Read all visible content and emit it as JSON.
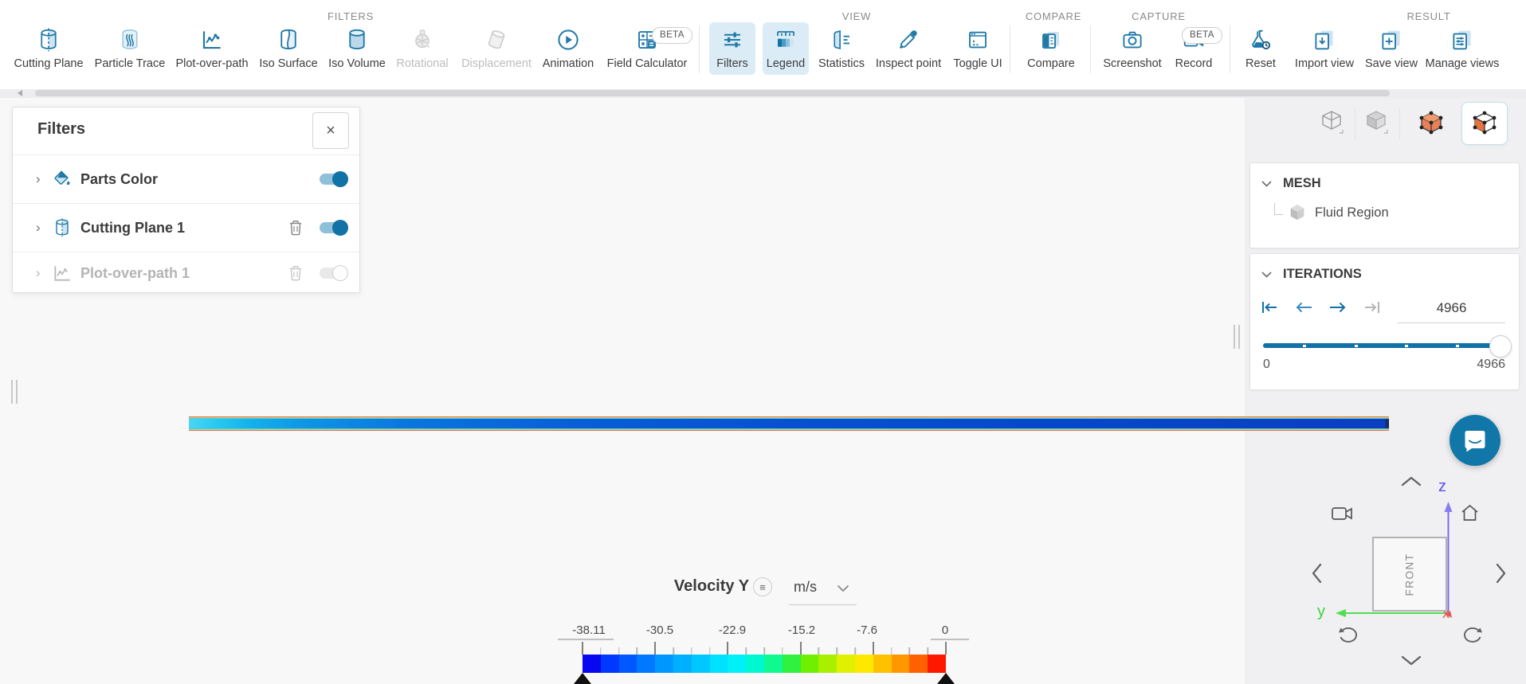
{
  "toolbar": {
    "beta_label": "BETA",
    "sections": [
      {
        "label": "FILTERS",
        "items": [
          {
            "label": "Cutting Plane"
          },
          {
            "label": "Particle Trace"
          },
          {
            "label": "Plot-over-path"
          },
          {
            "label": "Iso Surface"
          },
          {
            "label": "Iso Volume"
          },
          {
            "label": "Rotational",
            "disabled": true
          },
          {
            "label": "Displacement",
            "disabled": true
          },
          {
            "label": "Animation"
          },
          {
            "label": "Field Calculator",
            "beta": true
          }
        ]
      },
      {
        "label": "VIEW",
        "items": [
          {
            "label": "Filters",
            "active": true
          },
          {
            "label": "Legend",
            "active": true
          },
          {
            "label": "Statistics"
          },
          {
            "label": "Inspect point"
          },
          {
            "label": "Toggle UI"
          }
        ]
      },
      {
        "label": "COMPARE",
        "items": [
          {
            "label": "Compare"
          }
        ]
      },
      {
        "label": "CAPTURE",
        "items": [
          {
            "label": "Screenshot"
          },
          {
            "label": "Record",
            "beta": true
          }
        ]
      },
      {
        "label": "RESULT",
        "items": [
          {
            "label": "Reset"
          },
          {
            "label": "Import view"
          },
          {
            "label": "Save view"
          },
          {
            "label": "Manage views"
          }
        ]
      }
    ]
  },
  "filters_panel": {
    "title": "Filters",
    "rows": [
      {
        "name": "Parts Color",
        "toggle": "on"
      },
      {
        "name": "Cutting Plane 1",
        "toggle": "on",
        "deletable": true
      },
      {
        "name": "Plot-over-path 1",
        "toggle": "off",
        "deletable": true,
        "disabled": true
      }
    ]
  },
  "mesh_panel": {
    "title": "MESH",
    "item": "Fluid Region"
  },
  "iterations_panel": {
    "title": "ITERATIONS",
    "current": "4966",
    "min": "0",
    "max": "4966"
  },
  "legend": {
    "title": "Velocity Y",
    "unit": "m/s",
    "tick_labels": [
      "-38.11",
      "-30.5",
      "-22.9",
      "-15.2",
      "-7.6",
      "0"
    ],
    "colors": [
      "#0808f0",
      "#0038ff",
      "#0058ff",
      "#0078ff",
      "#0098ff",
      "#00b0ff",
      "#00c8ff",
      "#00e0ff",
      "#00f0f8",
      "#00f8d0",
      "#10f890",
      "#30f040",
      "#70f000",
      "#a8f000",
      "#e0f000",
      "#ffe800",
      "#ffc000",
      "#ff9800",
      "#ff6000",
      "#ff1800"
    ]
  },
  "chart_data": {
    "type": "colorbar",
    "title": "Velocity Y",
    "unit": "m/s",
    "min": -38.11,
    "max": 0,
    "tick_values": [
      -38.11,
      -30.5,
      -22.9,
      -15.2,
      -7.6,
      0
    ],
    "segments": 20,
    "colormap": "rainbow (blue to red)"
  },
  "nav_widget": {
    "front_label": "FRONT",
    "axis_x": "x",
    "axis_y": "y",
    "axis_z": "z"
  },
  "icons": {
    "close": "×",
    "chevron_right": "›",
    "menu": "≡"
  },
  "accent_colors": {
    "primary_blue": "#1271a5",
    "icon_blue": "#2079a8",
    "active_bg": "#dcecf6"
  }
}
